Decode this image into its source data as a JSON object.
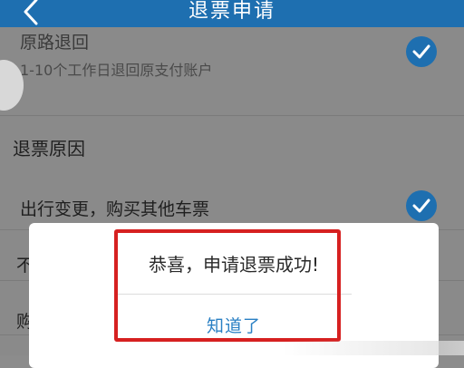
{
  "header": {
    "title": "退票申请",
    "back_icon": "chevron-left-icon",
    "background": "#1e6fb0"
  },
  "refund_method": {
    "title": "原路退回",
    "subtitle": "1-10个工作日退回原支付账户",
    "selected": true
  },
  "reasons": {
    "section_title": "退票原因",
    "items": [
      {
        "label": "出行变更，购买其他车票",
        "selected": true
      },
      {
        "label": "不",
        "selected": false
      },
      {
        "label": "购",
        "selected": false
      }
    ]
  },
  "dialog": {
    "message": "恭喜，申请退票成功!",
    "button_label": "知道了",
    "button_color": "#2a80c4"
  },
  "annotation": {
    "highlight_color": "#d62020"
  }
}
